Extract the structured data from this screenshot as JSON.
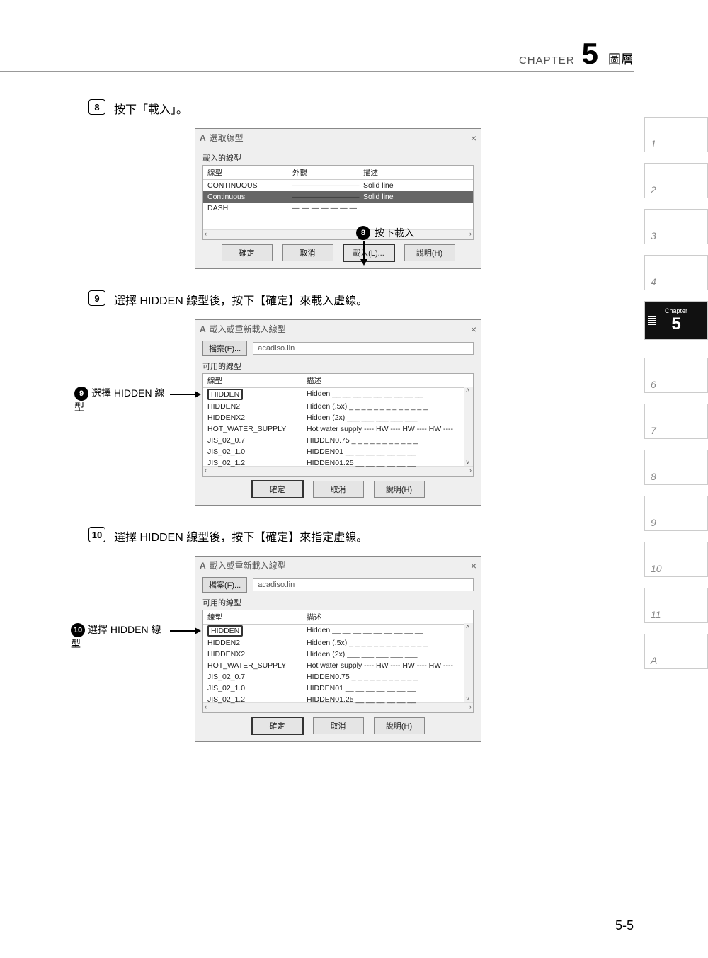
{
  "header": {
    "chapter_label": "CHAPTER",
    "chapter_num": "5",
    "chapter_title": "圖層"
  },
  "side_tabs": [
    "1",
    "2",
    "3",
    "4",
    {
      "top": "Chapter",
      "num": "5"
    },
    "6",
    "7",
    "8",
    "9",
    "10",
    "11",
    "A"
  ],
  "steps": {
    "s8": {
      "num": "8",
      "text": "按下「載入」。"
    },
    "s9": {
      "num": "9",
      "text": "選擇 HIDDEN 線型後，按下【確定】來載入虛線。"
    },
    "s10": {
      "num": "10",
      "text": "選擇 HIDDEN 線型後，按下【確定】來指定虛線。"
    }
  },
  "dialog1": {
    "title": "選取線型",
    "group": "載入的線型",
    "cols": {
      "name": "線型",
      "appearance": "外觀",
      "desc": "描述"
    },
    "rows": [
      {
        "name": "CONTINUOUS",
        "appearance": "―――――――――",
        "desc": "Solid line",
        "sel": false
      },
      {
        "name": "Continuous",
        "appearance": "―――――――――",
        "desc": "Solid line",
        "sel": true
      },
      {
        "name": "DASH",
        "appearance": "― ― ― ― ― ― ―",
        "desc": "",
        "sel": false
      }
    ],
    "buttons": {
      "ok": "確定",
      "cancel": "取消",
      "load": "載入(L)...",
      "help": "說明(H)"
    },
    "callout": "按下載入"
  },
  "dialog2": {
    "title": "載入或重新載入線型",
    "file_btn": "檔案(F)...",
    "file_path": "acadiso.lin",
    "group": "可用的線型",
    "cols": {
      "name": "線型",
      "desc": "描述"
    },
    "rows": [
      {
        "name": "HIDDEN",
        "desc": "Hidden __ __ __ __ __ __ __ __ __",
        "hl": true
      },
      {
        "name": "HIDDEN2",
        "desc": "Hidden (.5x) _ _ _ _ _ _ _ _ _ _ _ _ _"
      },
      {
        "name": "HIDDENX2",
        "desc": "Hidden (2x) ___ ___ ___ ___ ___"
      },
      {
        "name": "HOT_WATER_SUPPLY",
        "desc": "Hot water supply ---- HW ---- HW ---- HW ----"
      },
      {
        "name": "JIS_02_0.7",
        "desc": "HIDDEN0.75 _ _ _ _ _ _ _ _ _ _ _"
      },
      {
        "name": "JIS_02_1.0",
        "desc": "HIDDEN01 __ __ __ __ __ __ __"
      },
      {
        "name": "JIS_02_1.2",
        "desc": "HIDDEN01.25 __ __ __ __ __ __"
      }
    ],
    "buttons": {
      "ok": "確定",
      "cancel": "取消",
      "help": "說明(H)"
    }
  },
  "callout9": "選擇 HIDDEN 線型",
  "callout10": "選擇 HIDDEN 線型",
  "page_num": "5-5"
}
